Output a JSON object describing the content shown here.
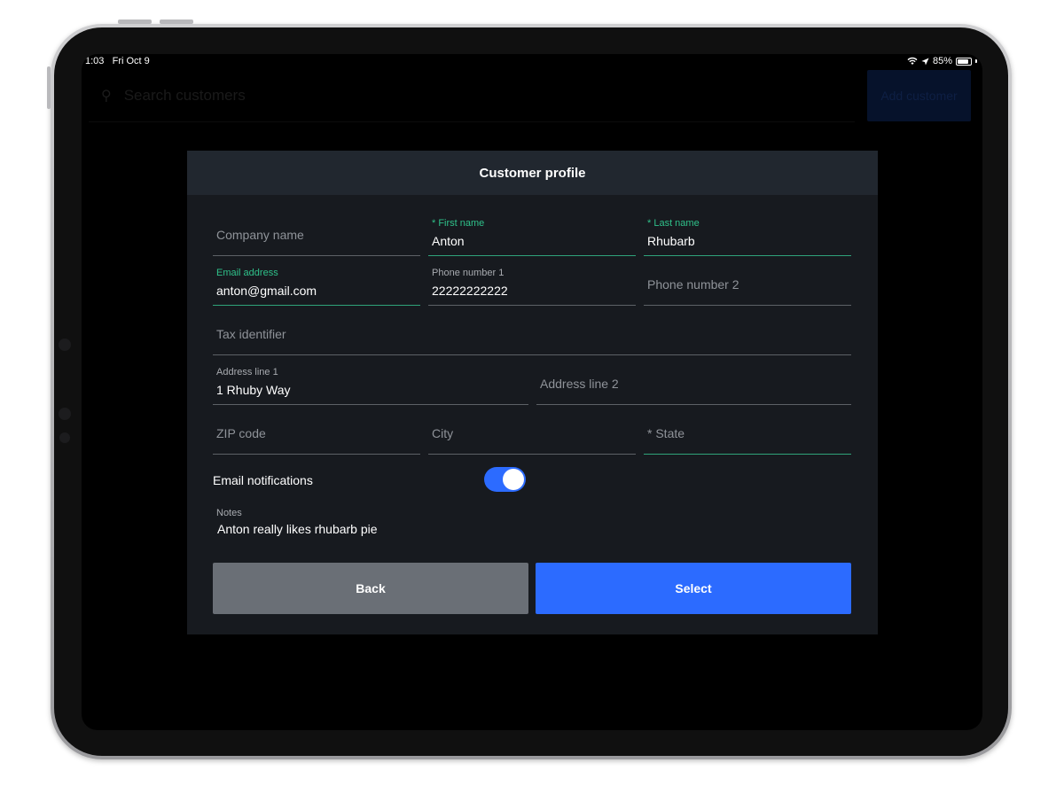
{
  "status_bar": {
    "time": "1:03",
    "date": "Fri Oct 9",
    "battery": "85%",
    "battery_level": 0.85
  },
  "background": {
    "search_placeholder": "Search customers",
    "add_customer_label": "Add customer"
  },
  "modal": {
    "title": "Customer profile",
    "fields": {
      "company_name": {
        "placeholder": "Company name"
      },
      "first_name": {
        "label": "* First name",
        "value": "Anton"
      },
      "last_name": {
        "label": "* Last name",
        "value": "Rhubarb"
      },
      "email": {
        "label": "Email address",
        "value": "anton@gmail.com"
      },
      "phone1": {
        "label": "Phone number 1",
        "value": "22222222222"
      },
      "phone2": {
        "placeholder": "Phone number 2"
      },
      "tax_identifier": {
        "placeholder": "Tax identifier"
      },
      "address1": {
        "label": "Address line 1",
        "value": "1 Rhuby Way"
      },
      "address2": {
        "placeholder": "Address line 2"
      },
      "zip": {
        "placeholder": "ZIP code"
      },
      "city": {
        "placeholder": "City"
      },
      "state": {
        "placeholder": "* State"
      }
    },
    "email_notifications": {
      "label": "Email notifications",
      "enabled": true
    },
    "notes": {
      "label": "Notes",
      "value": "Anton really likes rhubarb pie"
    },
    "back_label": "Back",
    "select_label": "Select"
  },
  "colors": {
    "accent": "#2c6bff",
    "focus_green": "#2fc18a",
    "modal_bg": "#171a1f",
    "header_bg": "#21272f",
    "back_button": "#6a6f76"
  }
}
